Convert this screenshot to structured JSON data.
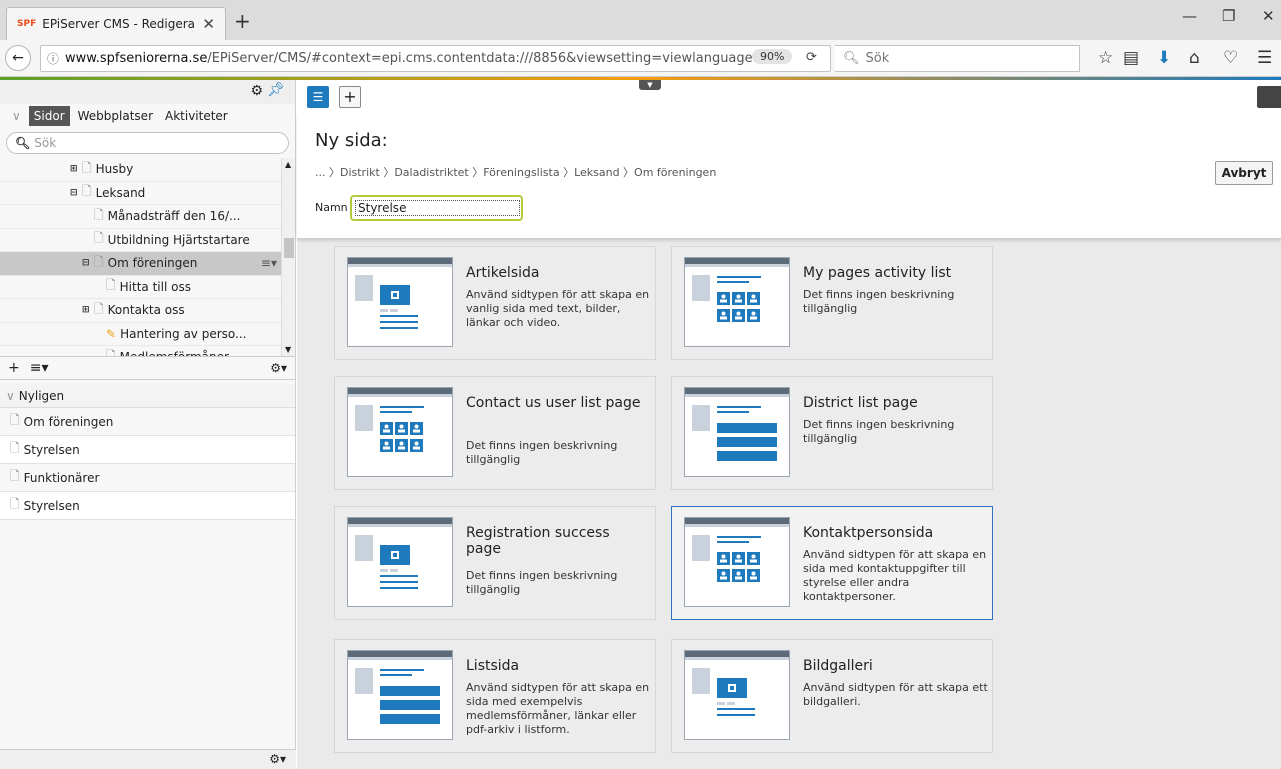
{
  "browser": {
    "tab_title": "EPiServer CMS - Redigera",
    "tab_favicon": "SPF",
    "url_host": "www.spfseniorerna.se",
    "url_path": "/EPiServer/CMS/#context=epi.cms.contentdata:///8856&viewsetting=viewlanguage:///sv",
    "zoom": "90%",
    "search_placeholder": "Sök"
  },
  "left_panel": {
    "tabs": [
      "Sidor",
      "Webbplatser",
      "Aktiviteter"
    ],
    "search_placeholder": "Sök",
    "tree": [
      {
        "label": "Husby",
        "indent": 3,
        "expander": "plus"
      },
      {
        "label": "Leksand",
        "indent": 3,
        "expander": "minus"
      },
      {
        "label": "Månadsträff den 16/...",
        "indent": 4,
        "expander": "none"
      },
      {
        "label": "Utbildning Hjärtstartare",
        "indent": 4,
        "expander": "none"
      },
      {
        "label": "Om föreningen",
        "indent": 4,
        "expander": "minus",
        "selected": true
      },
      {
        "label": "Hitta till oss",
        "indent": 5,
        "expander": "none"
      },
      {
        "label": "Kontakta oss",
        "indent": 4,
        "expander": "plus"
      },
      {
        "label": "Hantering av perso...",
        "indent": 5,
        "expander": "none",
        "icon": "edit"
      },
      {
        "label": "Medlemsförmåner",
        "indent": 5,
        "expander": "none"
      }
    ],
    "recent_title": "Nyligen",
    "recent": [
      "Om föreningen",
      "Styrelsen",
      "Funktionärer",
      "Styrelsen"
    ]
  },
  "new_page": {
    "title": "Ny sida:",
    "breadcrumb": "... 〉Distrikt 〉Daladistriktet 〉Föreningslista 〉Leksand 〉Om föreningen",
    "cancel_label": "Avbryt",
    "name_label": "Namn",
    "name_value": "Styrelse"
  },
  "page_types": [
    {
      "name": "Artikelsida",
      "desc": "Använd sidtypen för att skapa en vanlig sida med text, bilder, länkar och video.",
      "icon": "article"
    },
    {
      "name": "My pages activity list",
      "desc": "Det finns ingen beskrivning tillgänglig",
      "icon": "people"
    },
    {
      "name": "Contact us user list page",
      "desc": "Det finns ingen beskrivning tillgänglig",
      "icon": "people"
    },
    {
      "name": "District list page",
      "desc": "Det finns ingen beskrivning tillgänglig",
      "icon": "list"
    },
    {
      "name": "Registration success page",
      "desc": "Det finns ingen beskrivning tillgänglig",
      "icon": "article"
    },
    {
      "name": "Kontaktpersonsida",
      "desc": "Använd sidtypen för att skapa en sida med kontaktuppgifter till styrelse eller andra kontaktpersoner.",
      "icon": "people",
      "highlighted": true
    },
    {
      "name": "Listsida",
      "desc": "Använd sidtypen för att skapa en sida med exempelvis medlemsförmåner, länkar eller pdf-arkiv i listform.",
      "icon": "list"
    },
    {
      "name": "Bildgalleri",
      "desc": "Använd sidtypen för att skapa ett bildgalleri.",
      "icon": "gallery"
    }
  ],
  "colors": {
    "accent_blue": "#1e7abd",
    "highlight_border": "#2d6fc1",
    "name_input_border": "#b7c93a"
  }
}
